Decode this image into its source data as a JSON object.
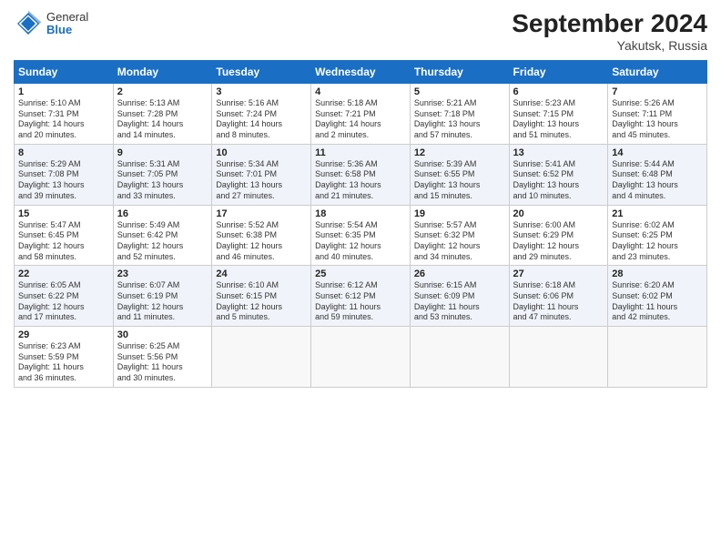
{
  "header": {
    "logo_general": "General",
    "logo_blue": "Blue",
    "title": "September 2024",
    "location": "Yakutsk, Russia"
  },
  "weekdays": [
    "Sunday",
    "Monday",
    "Tuesday",
    "Wednesday",
    "Thursday",
    "Friday",
    "Saturday"
  ],
  "weeks": [
    [
      {
        "day": "1",
        "info": "Sunrise: 5:10 AM\nSunset: 7:31 PM\nDaylight: 14 hours\nand 20 minutes."
      },
      {
        "day": "2",
        "info": "Sunrise: 5:13 AM\nSunset: 7:28 PM\nDaylight: 14 hours\nand 14 minutes."
      },
      {
        "day": "3",
        "info": "Sunrise: 5:16 AM\nSunset: 7:24 PM\nDaylight: 14 hours\nand 8 minutes."
      },
      {
        "day": "4",
        "info": "Sunrise: 5:18 AM\nSunset: 7:21 PM\nDaylight: 14 hours\nand 2 minutes."
      },
      {
        "day": "5",
        "info": "Sunrise: 5:21 AM\nSunset: 7:18 PM\nDaylight: 13 hours\nand 57 minutes."
      },
      {
        "day": "6",
        "info": "Sunrise: 5:23 AM\nSunset: 7:15 PM\nDaylight: 13 hours\nand 51 minutes."
      },
      {
        "day": "7",
        "info": "Sunrise: 5:26 AM\nSunset: 7:11 PM\nDaylight: 13 hours\nand 45 minutes."
      }
    ],
    [
      {
        "day": "8",
        "info": "Sunrise: 5:29 AM\nSunset: 7:08 PM\nDaylight: 13 hours\nand 39 minutes."
      },
      {
        "day": "9",
        "info": "Sunrise: 5:31 AM\nSunset: 7:05 PM\nDaylight: 13 hours\nand 33 minutes."
      },
      {
        "day": "10",
        "info": "Sunrise: 5:34 AM\nSunset: 7:01 PM\nDaylight: 13 hours\nand 27 minutes."
      },
      {
        "day": "11",
        "info": "Sunrise: 5:36 AM\nSunset: 6:58 PM\nDaylight: 13 hours\nand 21 minutes."
      },
      {
        "day": "12",
        "info": "Sunrise: 5:39 AM\nSunset: 6:55 PM\nDaylight: 13 hours\nand 15 minutes."
      },
      {
        "day": "13",
        "info": "Sunrise: 5:41 AM\nSunset: 6:52 PM\nDaylight: 13 hours\nand 10 minutes."
      },
      {
        "day": "14",
        "info": "Sunrise: 5:44 AM\nSunset: 6:48 PM\nDaylight: 13 hours\nand 4 minutes."
      }
    ],
    [
      {
        "day": "15",
        "info": "Sunrise: 5:47 AM\nSunset: 6:45 PM\nDaylight: 12 hours\nand 58 minutes."
      },
      {
        "day": "16",
        "info": "Sunrise: 5:49 AM\nSunset: 6:42 PM\nDaylight: 12 hours\nand 52 minutes."
      },
      {
        "day": "17",
        "info": "Sunrise: 5:52 AM\nSunset: 6:38 PM\nDaylight: 12 hours\nand 46 minutes."
      },
      {
        "day": "18",
        "info": "Sunrise: 5:54 AM\nSunset: 6:35 PM\nDaylight: 12 hours\nand 40 minutes."
      },
      {
        "day": "19",
        "info": "Sunrise: 5:57 AM\nSunset: 6:32 PM\nDaylight: 12 hours\nand 34 minutes."
      },
      {
        "day": "20",
        "info": "Sunrise: 6:00 AM\nSunset: 6:29 PM\nDaylight: 12 hours\nand 29 minutes."
      },
      {
        "day": "21",
        "info": "Sunrise: 6:02 AM\nSunset: 6:25 PM\nDaylight: 12 hours\nand 23 minutes."
      }
    ],
    [
      {
        "day": "22",
        "info": "Sunrise: 6:05 AM\nSunset: 6:22 PM\nDaylight: 12 hours\nand 17 minutes."
      },
      {
        "day": "23",
        "info": "Sunrise: 6:07 AM\nSunset: 6:19 PM\nDaylight: 12 hours\nand 11 minutes."
      },
      {
        "day": "24",
        "info": "Sunrise: 6:10 AM\nSunset: 6:15 PM\nDaylight: 12 hours\nand 5 minutes."
      },
      {
        "day": "25",
        "info": "Sunrise: 6:12 AM\nSunset: 6:12 PM\nDaylight: 11 hours\nand 59 minutes."
      },
      {
        "day": "26",
        "info": "Sunrise: 6:15 AM\nSunset: 6:09 PM\nDaylight: 11 hours\nand 53 minutes."
      },
      {
        "day": "27",
        "info": "Sunrise: 6:18 AM\nSunset: 6:06 PM\nDaylight: 11 hours\nand 47 minutes."
      },
      {
        "day": "28",
        "info": "Sunrise: 6:20 AM\nSunset: 6:02 PM\nDaylight: 11 hours\nand 42 minutes."
      }
    ],
    [
      {
        "day": "29",
        "info": "Sunrise: 6:23 AM\nSunset: 5:59 PM\nDaylight: 11 hours\nand 36 minutes."
      },
      {
        "day": "30",
        "info": "Sunrise: 6:25 AM\nSunset: 5:56 PM\nDaylight: 11 hours\nand 30 minutes."
      },
      {
        "day": "",
        "info": ""
      },
      {
        "day": "",
        "info": ""
      },
      {
        "day": "",
        "info": ""
      },
      {
        "day": "",
        "info": ""
      },
      {
        "day": "",
        "info": ""
      }
    ]
  ]
}
